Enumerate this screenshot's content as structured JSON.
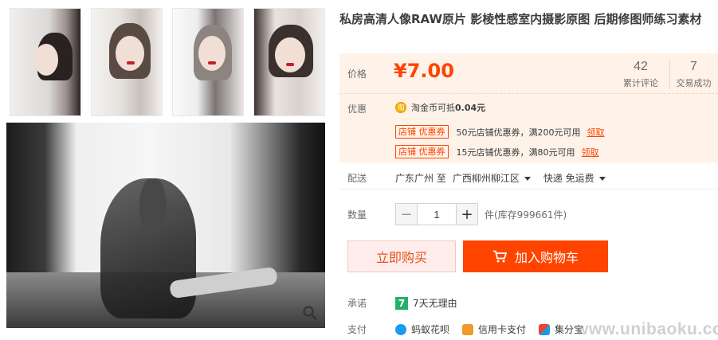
{
  "product": {
    "title": "私房高清人像RAW原片 影棱性感室内摄影原图 后期修图师练习素材"
  },
  "price": {
    "label": "价格",
    "value": "¥7.00"
  },
  "stats": [
    {
      "num": "42",
      "label": "累计评论"
    },
    {
      "num": "7",
      "label": "交易成功"
    }
  ],
  "promo": {
    "label": "优惠",
    "coin_icon": "淘",
    "coin_text": "淘金币可抵",
    "coin_amount": "0.04元",
    "coupons": [
      {
        "tag": "店铺 优惠券",
        "text": "50元店铺优惠券，满200元可用",
        "action": "领取"
      },
      {
        "tag": "店铺 优惠券",
        "text": "15元店铺优惠券，满80元可用",
        "action": "领取"
      }
    ]
  },
  "shipping": {
    "label": "配送",
    "from": "广东广州 至",
    "to": "广西柳州柳江区",
    "method": "快递 免运费"
  },
  "quantity": {
    "label": "数量",
    "value": "1",
    "minus": "−",
    "plus": "+",
    "stock": "件(库存999661件)"
  },
  "actions": {
    "buy_now": "立即购买",
    "add_to_cart": "加入购物车"
  },
  "promise": {
    "label": "承诺",
    "icon_text": "7",
    "text": "7天无理由"
  },
  "payment": {
    "label": "支付",
    "methods": [
      "蚂蚁花呗",
      "信用卡支付",
      "集分宝"
    ]
  },
  "watermark": "www.unibaoku.com",
  "colors": {
    "accent": "#ff4400",
    "price_bg": "#fff2e8",
    "buy_now_bg": "#ffeded"
  }
}
